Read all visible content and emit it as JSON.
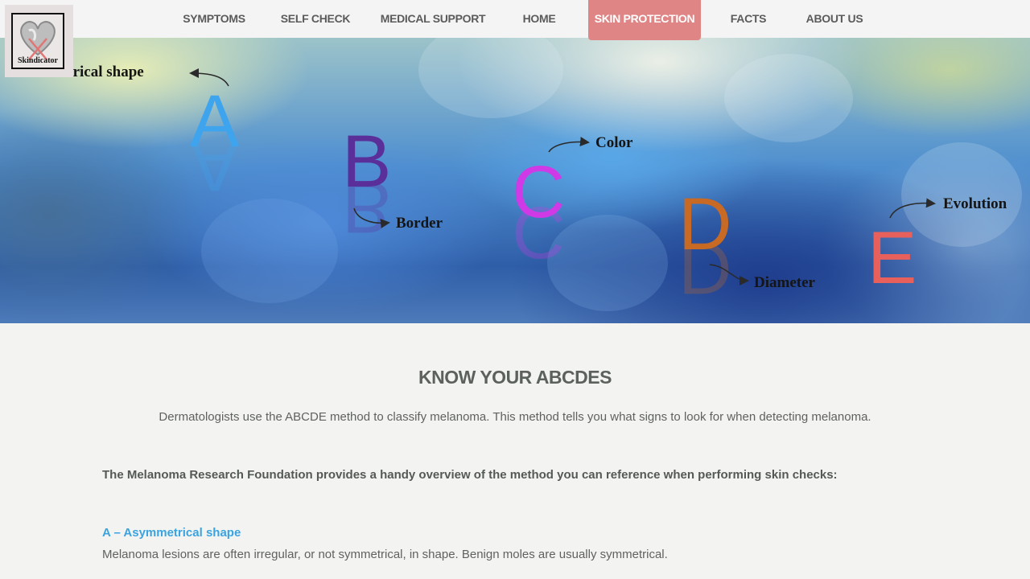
{
  "nav": {
    "items": [
      {
        "label": "SYMPTOMS"
      },
      {
        "label": "SELF CHECK"
      },
      {
        "label": "MEDICAL SUPPORT"
      },
      {
        "label": "HOME"
      },
      {
        "label": "SKIN PROTECTION"
      },
      {
        "label": "FACTS"
      },
      {
        "label": "ABOUT US"
      }
    ],
    "active": "SKIN PROTECTION"
  },
  "logo": {
    "text": "Skindicator",
    "icon": "heart-icon"
  },
  "hero": {
    "letters": [
      "A",
      "B",
      "C",
      "D",
      "E"
    ],
    "labels": {
      "a": "metrical shape",
      "b": "Border",
      "c": "Color",
      "d": "Diameter",
      "e": "Evolution"
    },
    "colors": {
      "a": "#3fa4ee",
      "b": "#5a2f9a",
      "c": "#d03ae6",
      "d": "#c86a24",
      "e": "#e8605c"
    }
  },
  "content": {
    "heading": "KNOW YOUR ABCDES",
    "intro": "Dermatologists use the ABCDE method to classify melanoma. This method tells you what signs to look for when detecting melanoma.",
    "lead": "The Melanoma Research Foundation provides a handy overview of the method you can reference when performing skin checks:",
    "items": [
      {
        "title": "A – Asymmetrical shape",
        "text": "Melanoma lesions are often irregular, or not symmetrical, in shape. Benign moles are usually symmetrical."
      }
    ]
  },
  "colors": {
    "accent": "#e08585",
    "link": "#3aa3e0",
    "heading": "#5c615d"
  }
}
